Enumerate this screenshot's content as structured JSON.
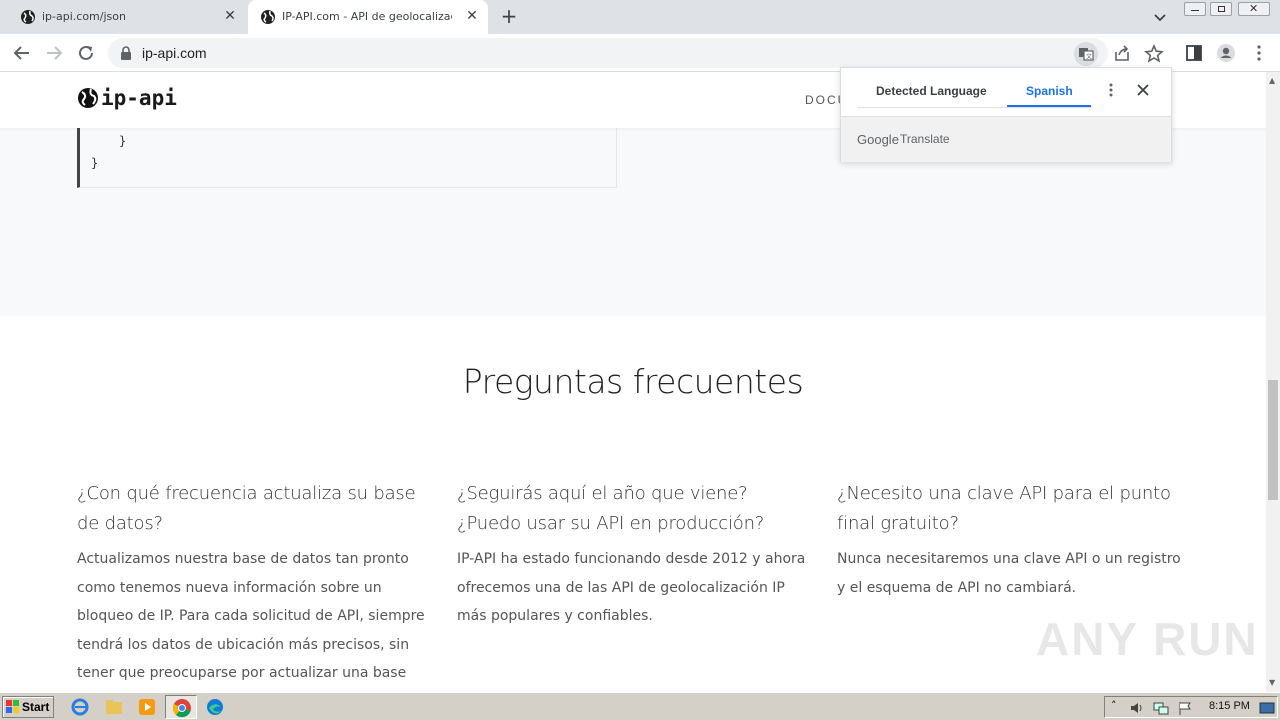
{
  "browser": {
    "tabs": [
      {
        "title": "ip-api.com/json",
        "active": false
      },
      {
        "title": "IP-API.com - API de geolocalización",
        "active": true
      }
    ],
    "new_tab_label": "+",
    "close_glyph": "✕",
    "url": "ip-api.com"
  },
  "site": {
    "logo_text": "ip-api",
    "nav_partial": "DOCU",
    "code_lines": [
      "}",
      "}"
    ]
  },
  "faq": {
    "title": "Preguntas frecuentes",
    "items": [
      {
        "question": "¿Con qué frecuencia actualiza su base de datos?",
        "answer": "Actualizamos nuestra base de datos tan pronto como tenemos nueva información sobre un bloqueo de IP. Para cada solicitud de API, siempre tendrá los datos de ubicación más precisos, sin tener que preocuparse por actualizar una base de"
      },
      {
        "question": "¿Seguirás aquí el año que viene? ¿Puedo usar su API en producción?",
        "answer": "IP-API ha estado funcionando desde 2012 y ahora ofrecemos una de las API de geolocalización IP más populares y confiables."
      },
      {
        "question": "¿Necesito una clave API para el punto final gratuito?",
        "answer": "Nunca necesitaremos una clave API o un registro y el esquema de API no cambiará."
      }
    ]
  },
  "translate_popup": {
    "tab_detected": "Detected Language",
    "tab_target": "Spanish",
    "brand": "Google",
    "product": "Translate",
    "accent_color": "#1a73e8"
  },
  "watermark": "ANY RUN",
  "taskbar": {
    "start_label": "Start",
    "clock": "8:15 PM"
  }
}
